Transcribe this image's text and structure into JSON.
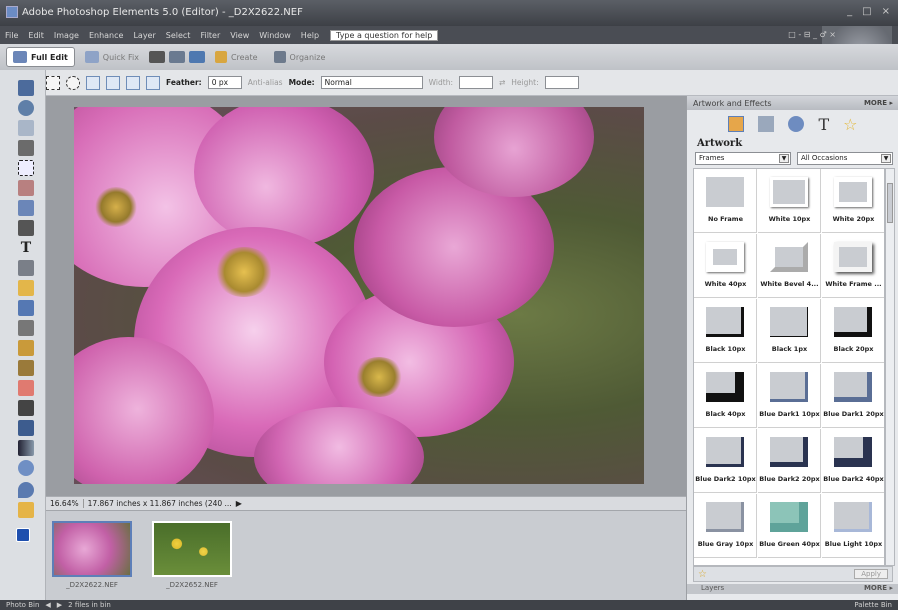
{
  "window": {
    "title": "Adobe Photoshop Elements 5.0 (Editor) - _D2X2622.NEF",
    "controls": [
      "_",
      "□",
      "×"
    ]
  },
  "menu": {
    "items": [
      "File",
      "Edit",
      "Image",
      "Enhance",
      "Layer",
      "Select",
      "Filter",
      "View",
      "Window",
      "Help"
    ],
    "help_placeholder": "Type a question for help",
    "mini_controls": "□ - ⊟ _ ♂ ×"
  },
  "modebar": {
    "full_edit": "Full Edit",
    "quick_fix": "Quick Fix",
    "create": "Create",
    "organize": "Organize"
  },
  "options": {
    "feather_label": "Feather:",
    "feather_value": "0 px",
    "antialias_label": "Anti-alias",
    "mode_label": "Mode:",
    "mode_value": "Normal",
    "width_label": "Width:",
    "height_label": "Height:"
  },
  "status": {
    "zoom": "16.64%",
    "doc_size": "17.867 inches x 11.867 inches (240 ..."
  },
  "photo_bin": {
    "thumbs": [
      {
        "label": "_D2X2622.NEF",
        "selected": true
      },
      {
        "label": "_D2X2652.NEF",
        "selected": false
      }
    ]
  },
  "palette": {
    "header": "Artwork and Effects",
    "more": "MORE ▸",
    "title": "Artwork",
    "category": "Frames",
    "occasion": "All Occasions",
    "items": [
      "No Frame",
      "White 10px",
      "White 20px",
      "White 40px",
      "White Bevel 4...",
      "White Frame ...",
      "Black 10px",
      "Black 1px",
      "Black 20px",
      "Black 40px",
      "Blue Dark1 10px",
      "Blue Dark1 20px",
      "Blue Dark2 10px",
      "Blue Dark2 20px",
      "Blue Dark2 40px",
      "Blue Gray 10px",
      "Blue Green 40px",
      "Blue Light 10px"
    ],
    "apply": "Apply",
    "layers": "Layers",
    "layers_more": "MORE ▸"
  },
  "bottom": {
    "photo_bin": "Photo Bin",
    "files": "2 files in bin",
    "palette_bin": "Palette Bin"
  },
  "colors": {
    "accent": "#5d7fb8",
    "title_bg": "#3d4046",
    "menu_bg": "#4a4d54"
  }
}
